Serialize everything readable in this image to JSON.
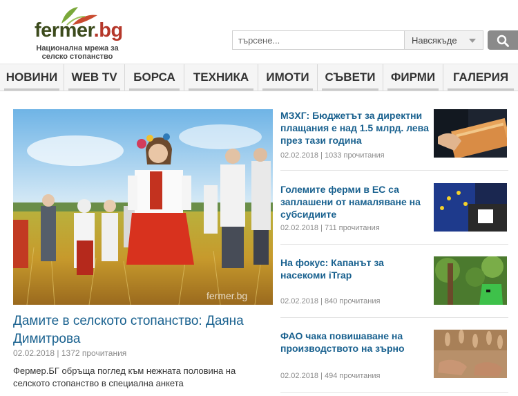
{
  "header": {
    "logo": {
      "fermer": "fermer",
      "dot": ".",
      "bg": "bg"
    },
    "tagline": "Национална мрежа за селско стопанство",
    "search": {
      "placeholder": "търсене...",
      "scope": "Навсякъде"
    }
  },
  "nav": {
    "items": [
      {
        "label": "НОВИНИ"
      },
      {
        "label": "WEB TV"
      },
      {
        "label": "БОРСА"
      },
      {
        "label": "ТЕХНИКА"
      },
      {
        "label": "ИМОТИ"
      },
      {
        "label": "СЪВЕТИ"
      },
      {
        "label": "ФИРМИ"
      },
      {
        "label": "ГАЛЕРИЯ"
      }
    ]
  },
  "main_article": {
    "title": "Дамите в селското стопанство: Даяна Димитрова",
    "meta": "02.02.2018 | 1372 прочитания",
    "description": "Фермер.БГ обръща поглед към нежната половина на селското стопанство в специална анкета",
    "watermark": "fermer.bg"
  },
  "side_articles": [
    {
      "title": "МЗХГ: Бюджетът за директни плащания е над 1.5 млрд. лева през тази година",
      "meta": "02.02.2018 | 1033 прочитания",
      "thumb": "money-photo"
    },
    {
      "title": "Големите ферми в ЕС са заплашени от намаляване на субсидиите",
      "meta": "02.02.2018 | 711 прочитания",
      "thumb": "eu-flag-photo"
    },
    {
      "title": "На фокус: Капанът за насекоми iTrap",
      "meta": "02.02.2018 | 840 прочитания",
      "thumb": "insect-trap-photo"
    },
    {
      "title": "ФАО чака повишаване на производството на зърно",
      "meta": "02.02.2018 | 494 прочитания",
      "thumb": "grain-photo"
    }
  ]
}
